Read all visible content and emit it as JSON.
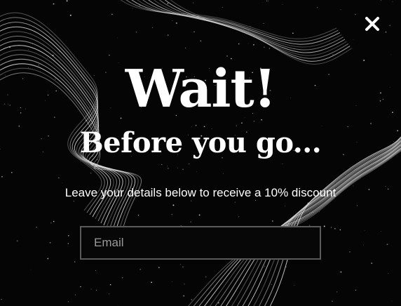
{
  "popup": {
    "headline": "Wait!",
    "subheadline": "Before you go...",
    "offer_text": "Leave your details below to receive a 10% discount",
    "email_placeholder": "Email",
    "email_value": "",
    "close_icon": "close-x-icon"
  },
  "colors": {
    "background": "#050505",
    "text": "#ffffff",
    "input_border": "#5a5a5a",
    "placeholder": "#9a9a9a"
  }
}
